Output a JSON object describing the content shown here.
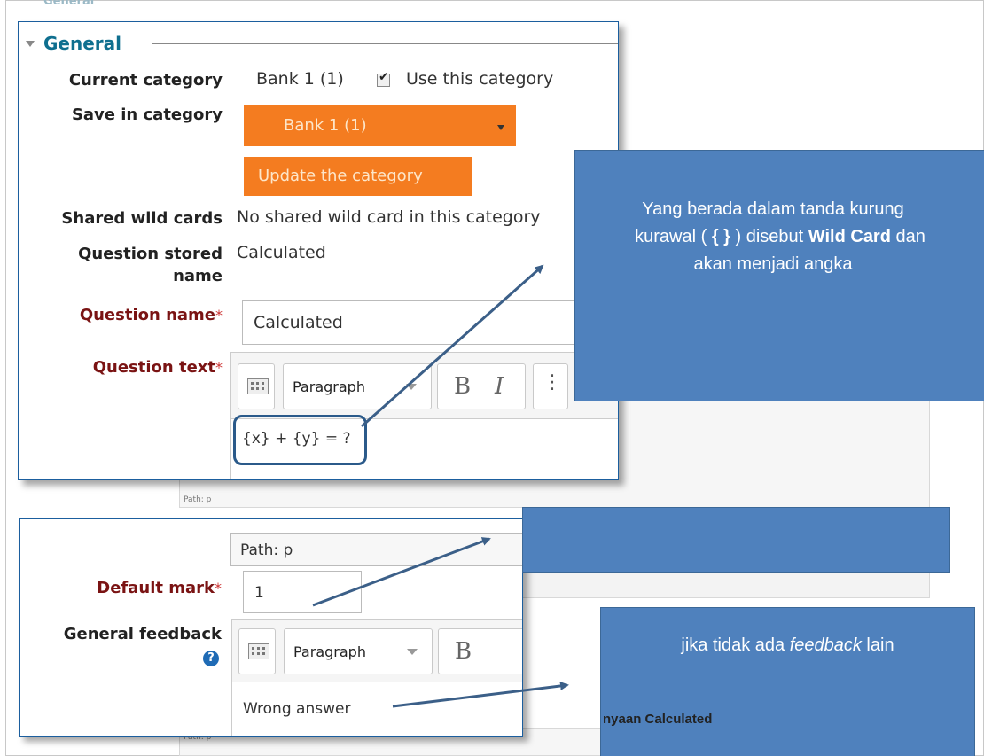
{
  "general": {
    "legend": "General",
    "fields": [
      {
        "label": "Current category",
        "value": "Bank 1 (1)",
        "checkbox_label": "Use this category",
        "checked": true
      },
      {
        "label": "Save in category",
        "select_value": "Bank 1 (1)",
        "button": "Update the category"
      },
      {
        "label": "Shared wild cards",
        "value": "No shared wild card in this category"
      },
      {
        "label_1": "Question stored",
        "label_2": "name",
        "value": "Calculated"
      },
      {
        "label": "Question name",
        "required_mark": "*",
        "value": "Calculated"
      },
      {
        "label": "Question text",
        "required_mark": "*",
        "format": "Paragraph",
        "bold": "B",
        "italic": "I",
        "content": "{x} + {y} = ?"
      }
    ]
  },
  "lower": {
    "path_text": "Path: p",
    "default_mark": {
      "label": "Default mark",
      "required_mark": "*",
      "value": "1"
    },
    "general_feedback": {
      "label": "General feedback",
      "help_icon": "?",
      "format": "Paragraph",
      "bold": "B",
      "content": "Wrong answer"
    }
  },
  "background": {
    "path_label": "Path: p",
    "path_label_bottom": "Path: p",
    "legend_peek": "General"
  },
  "callouts": {
    "wildcard": {
      "text_1": "Yang berada dalam tanda kurung",
      "text_2a": "kurawal ( ",
      "text_2b": "{ }",
      "text_2c": " ) disebut ",
      "text_2d": "Wild Card",
      "text_2e": " dan",
      "text_3": "akan menjadi angka"
    },
    "feedback": {
      "text_a": "jika tidak ada ",
      "text_b": "feedback",
      "text_c": " lain"
    },
    "caption_fragment": "nyaan Calculated"
  },
  "colors": {
    "orange": "#f47c20",
    "callout_blue": "#4f81bd",
    "legend_teal": "#0f6f8f",
    "required_red": "#7a1313"
  }
}
